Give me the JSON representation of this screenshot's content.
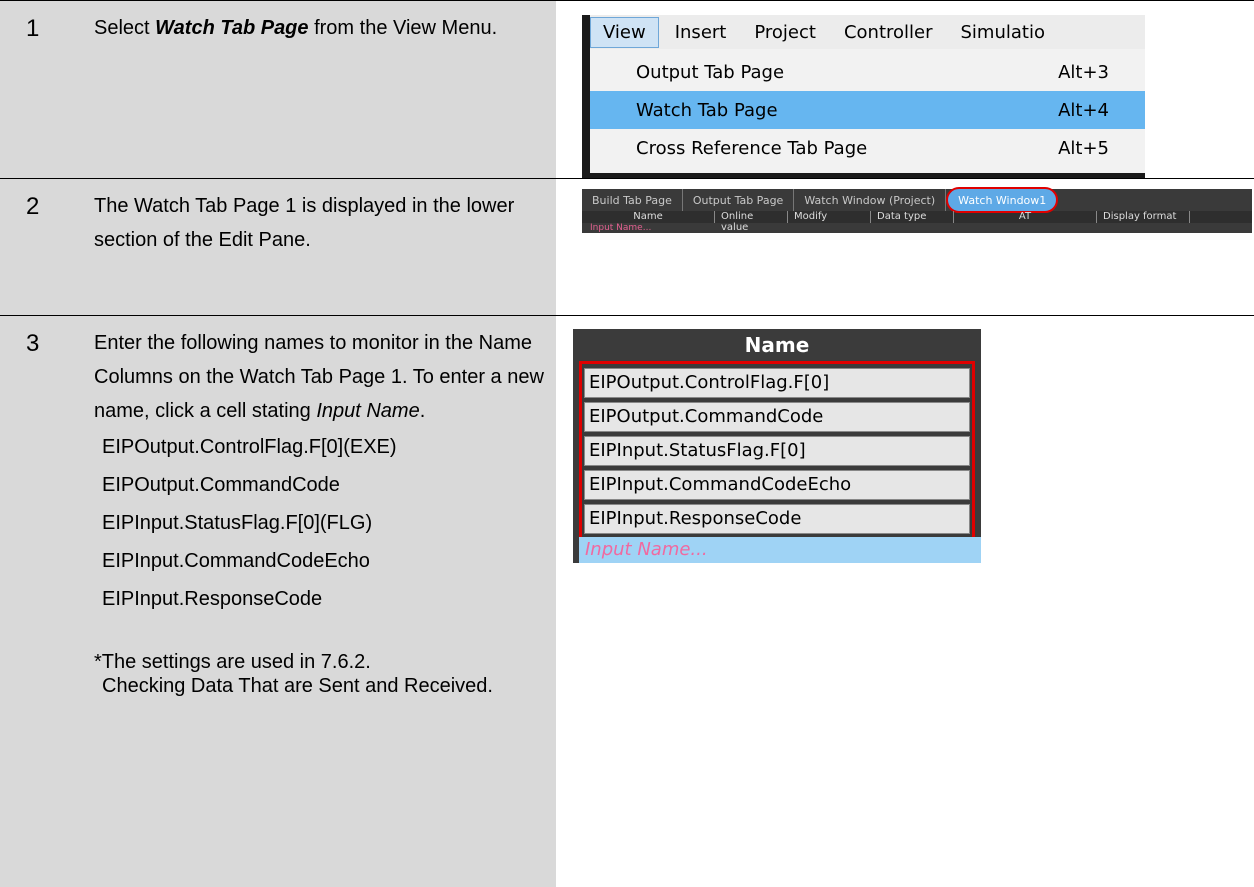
{
  "steps": [
    {
      "number": "1",
      "text_parts": {
        "pre": "Select ",
        "bold": "Watch Tab Page",
        "post": " from the View Menu."
      },
      "menu": {
        "bar": [
          "View",
          "Insert",
          "Project",
          "Controller",
          "Simulatio"
        ],
        "items": [
          {
            "label": "Output Tab Page",
            "shortcut": "Alt+3",
            "selected": false
          },
          {
            "label": "Watch Tab Page",
            "shortcut": "Alt+4",
            "selected": true
          },
          {
            "label": "Cross Reference Tab Page",
            "shortcut": "Alt+5",
            "selected": false
          }
        ]
      }
    },
    {
      "number": "2",
      "text": "The Watch Tab Page 1 is displayed in the lower section of the Edit Pane.",
      "tabs": [
        "Build Tab Page",
        "Output Tab Page",
        "Watch Window (Project)",
        "Watch Window1"
      ],
      "columns": [
        "Name",
        "Online value",
        "Modify",
        "Data type",
        "AT",
        "Display format"
      ],
      "input_placeholder": "Input Name..."
    },
    {
      "number": "3",
      "text_parts": {
        "pre": "Enter the following names to monitor in the Name Columns on the Watch Tab Page 1. To enter a new name, click a cell stating ",
        "italic": "Input Name",
        "post": "."
      },
      "list": [
        "EIPOutput.ControlFlag.F[0](EXE)",
        "EIPOutput.CommandCode",
        "EIPInput.StatusFlag.F[0](FLG)",
        "EIPInput.CommandCodeEcho",
        "EIPInput.ResponseCode"
      ],
      "note": "*The settings are used in 7.6.2.",
      "note_cont": "Checking Data That are Sent and Received.",
      "name_header": "Name",
      "names": [
        "EIPOutput.ControlFlag.F[0]",
        "EIPOutput.CommandCode",
        "EIPInput.StatusFlag.F[0]",
        "EIPInput.CommandCodeEcho",
        "EIPInput.ResponseCode"
      ],
      "input_placeholder": "Input Name..."
    }
  ]
}
